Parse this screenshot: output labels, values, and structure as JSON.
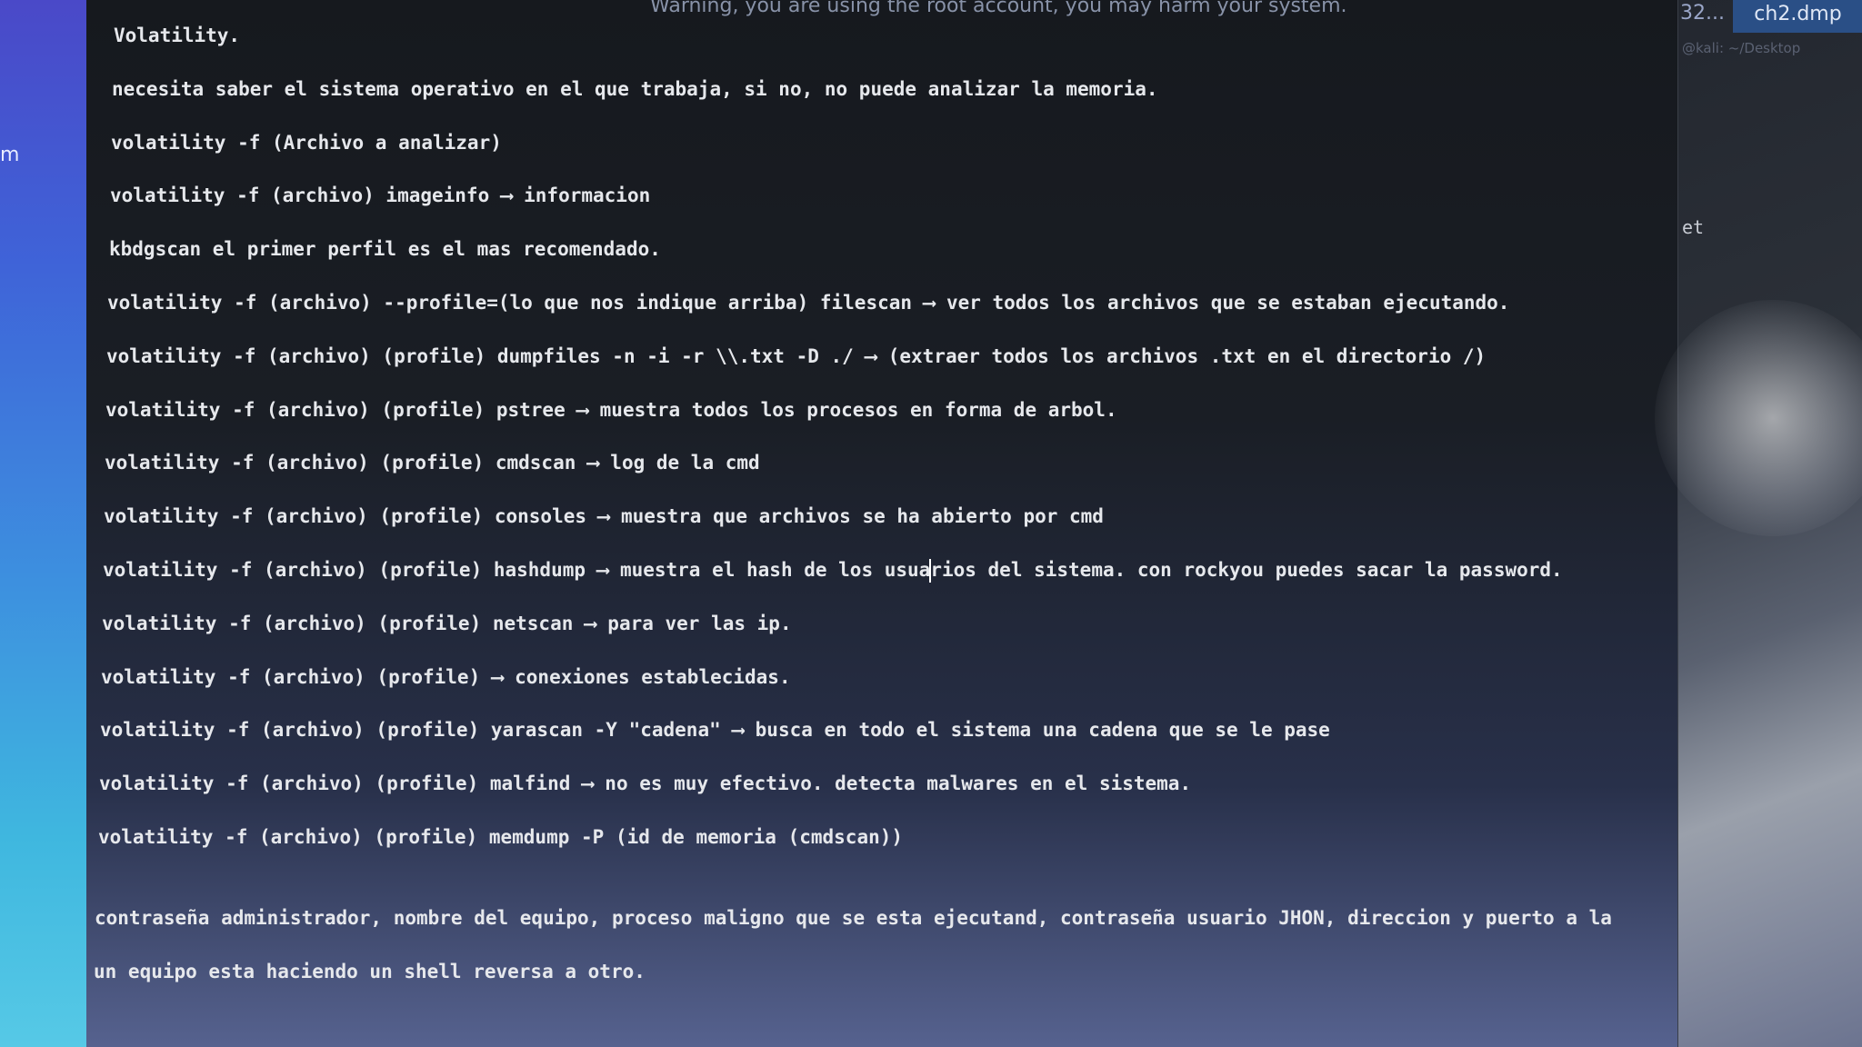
{
  "window": {
    "warning": "Warning, you are using the root account, you may harm your system."
  },
  "desktop": {
    "partial_label": "m"
  },
  "tabs": {
    "partial_tab": "32...",
    "active_tab": "ch2.dmp"
  },
  "side_panel": {
    "path_hint": "@kali: ~/Desktop",
    "partial_text": "et"
  },
  "document": {
    "lines": [
      "Volatility.",
      "necesita saber el sistema operativo en el que trabaja, si no, no puede analizar la memoria.",
      "volatility -f (Archivo a analizar)",
      "volatility -f (archivo) imageinfo ⟶ informacion",
      "kbdgscan el primer perfil es el mas recomendado.",
      "volatility -f (archivo) --profile=(lo que nos indique arriba) filescan ⟶ ver todos los archivos que se estaban ejecutando.",
      "volatility -f (archivo) (profile) dumpfiles -n -i -r \\\\.txt -D ./ ⟶ (extraer todos los archivos .txt en el directorio /)",
      "volatility -f (archivo) (profile) pstree ⟶ muestra todos los procesos en forma de arbol.",
      "volatility -f (archivo) (profile) cmdscan ⟶ log de la cmd",
      "volatility -f (archivo) (profile) consoles ⟶ muestra que archivos se ha abierto por cmd",
      "volatility -f (archivo) (profile) hashdump ⟶ muestra el hash de los usuarios del sistema. con rockyou puedes sacar la password.",
      "volatility -f (archivo) (profile) netscan ⟶ para ver las ip.",
      "volatility -f (archivo) (profile) ⟶ conexiones establecidas.",
      "volatility -f (archivo) (profile) yarascan -Y \"cadena\" ⟶ busca en todo el sistema una cadena que se le pase",
      "volatility -f (archivo) (profile) malfind ⟶ no es muy efectivo. detecta malwares en el sistema.",
      "volatility -f (archivo) (profile) memdump -P (id de memoria (cmdscan))",
      "contraseña administrador, nombre del equipo, proceso maligno que se esta ejecutand, contraseña usuario JHON, direccion y puerto a la",
      "un equipo esta haciendo un shell reversa a otro."
    ],
    "cursor": {
      "line_index": 10,
      "before": "volatility -f (archivo) (profile) hashdump ⟶ muestra el hash de los usua",
      "after": "rios del sistema. con rockyou puedes sacar la password."
    }
  }
}
